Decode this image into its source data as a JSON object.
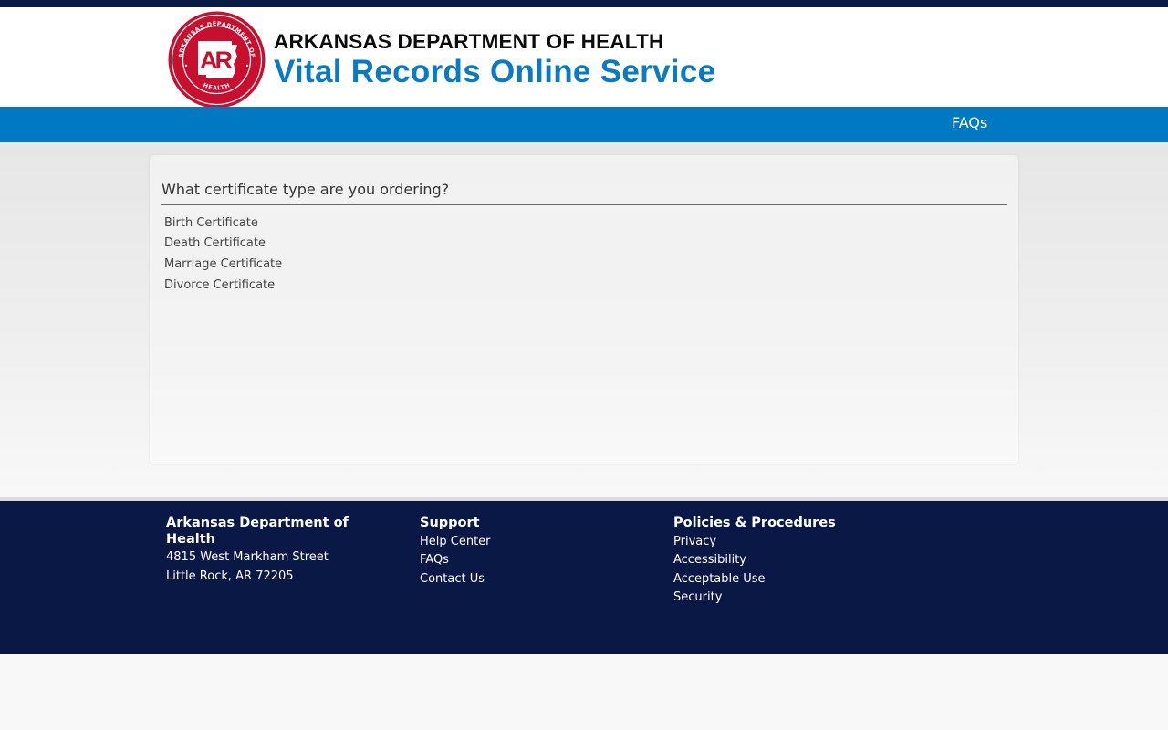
{
  "header": {
    "org_title": "ARKANSAS DEPARTMENT OF HEALTH",
    "service_title": "Vital Records Online Service",
    "seal": {
      "ring_text_top": "ARKANSAS DEPARTMENT OF",
      "ring_text_bottom": "HEALTH",
      "monogram": "AR",
      "colors": {
        "red": "#c8102e",
        "white": "#ffffff"
      }
    }
  },
  "nav": {
    "faqs_label": "FAQs"
  },
  "main": {
    "question": "What certificate type are you ordering?",
    "options": [
      {
        "label": "Birth Certificate"
      },
      {
        "label": "Death Certificate"
      },
      {
        "label": "Marriage Certificate"
      },
      {
        "label": "Divorce Certificate"
      }
    ]
  },
  "footer": {
    "org": {
      "heading": "Arkansas Department of Health",
      "address_line1": "4815 West Markham Street",
      "address_line2": "Little Rock, AR 72205"
    },
    "support": {
      "heading": "Support",
      "links": [
        "Help Center",
        "FAQs",
        "Contact Us"
      ]
    },
    "policies": {
      "heading": "Policies & Procedures",
      "links": [
        "Privacy",
        "Accessibility",
        "Acceptable Use",
        "Security"
      ]
    }
  },
  "colors": {
    "top_bar": "#0a1a47",
    "nav_blue": "#0078c2",
    "title_blue": "#0a7ac4",
    "footer_navy": "#091845"
  }
}
